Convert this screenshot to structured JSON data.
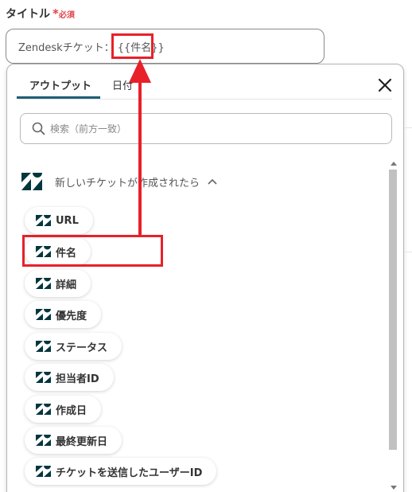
{
  "field": {
    "label": "タイトル",
    "required_mark": "*",
    "required_text": "必須",
    "input_prefix": "Zendeskチケット：",
    "input_token": "{{件名}}"
  },
  "dropdown": {
    "tabs": [
      {
        "label": "アウトプット",
        "active": true
      },
      {
        "label": "日付",
        "active": false
      }
    ],
    "search_placeholder": "検索（前方一致）",
    "section_title": "新しいチケットが作成されたら",
    "items": [
      {
        "label": "URL"
      },
      {
        "label": "件名"
      },
      {
        "label": "詳細"
      },
      {
        "label": "優先度"
      },
      {
        "label": "ステータス"
      },
      {
        "label": "担当者ID"
      },
      {
        "label": "作成日"
      },
      {
        "label": "最終更新日"
      },
      {
        "label": "チケットを送信したユーザーID"
      }
    ]
  },
  "icons": {
    "close": "close-icon",
    "search": "search-icon",
    "brand": "zendesk-logo-icon",
    "chevron": "chevron-up-icon"
  },
  "colors": {
    "annotation_red": "#e8202a",
    "required_red": "#e0434a",
    "tab_active": "#1f5e78",
    "zendesk_dark": "#03363d"
  }
}
